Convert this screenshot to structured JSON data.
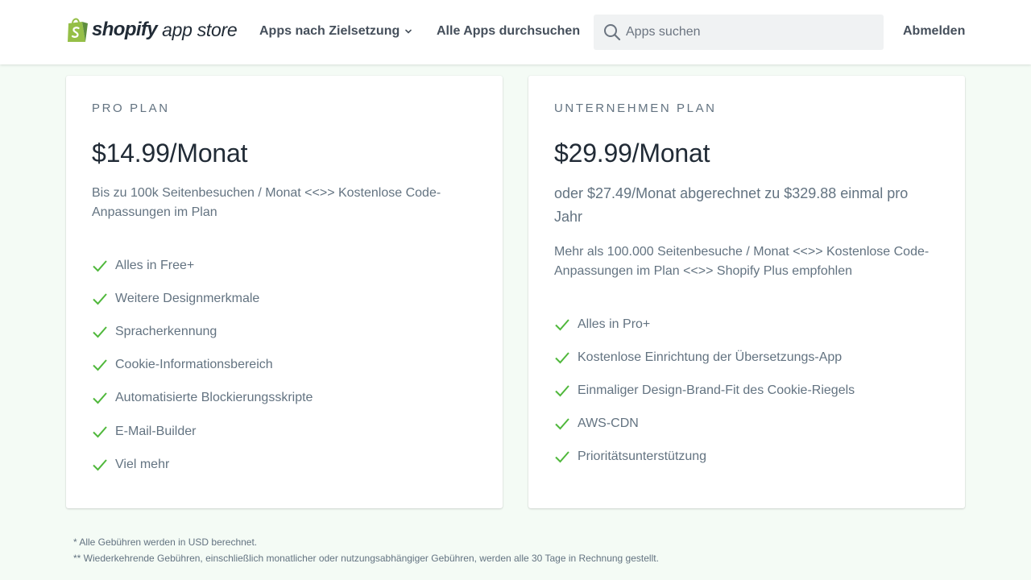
{
  "header": {
    "logo_word": "shopify",
    "logo_sub": "app store",
    "nav_goal_label": "Apps nach Zielsetzung",
    "nav_browse_label": "Alle Apps durchsuchen",
    "search_placeholder": "Apps suchen",
    "logout_label": "Abmelden"
  },
  "plans": [
    {
      "name": "PRO PLAN",
      "price": "$14.99/Monat",
      "description": "Bis zu 100k Seitenbesuchen / Monat <<>> Kostenlose Code-Anpassungen im Plan",
      "features": [
        "Alles in Free+",
        "Weitere Designmerkmale",
        "Spracherkennung",
        "Cookie-Informationsbereich",
        "Automatisierte Blockierungsskripte",
        "E-Mail-Builder",
        "Viel mehr"
      ]
    },
    {
      "name": "UNTERNEHMEN PLAN",
      "price": "$29.99/Monat",
      "annual_note": "oder $27.49/Monat abgerechnet zu $329.88 einmal pro Jahr",
      "description": "Mehr als 100.000 Seitenbesuche / Monat <<>> Kostenlose Code-Anpassungen im Plan <<>> Shopify Plus empfohlen",
      "features": [
        "Alles in Pro+",
        "Kostenlose Einrichtung der Übersetzungs-App",
        "Einmaliger Design-Brand-Fit des Cookie-Riegels",
        "AWS-CDN",
        "Prioritätsunterstützung"
      ]
    }
  ],
  "footnotes": [
    "* Alle Gebühren werden in USD berechnet.",
    "** Wiederkehrende Gebühren, einschließlich monatlicher oder nutzungsabhängiger Gebühren, werden alle 30 Tage in Rechnung gestellt."
  ],
  "colors": {
    "brand_green": "#95bf47",
    "brand_green_dark": "#5e8e3e",
    "check_green": "#50b83c",
    "page_background": "#f4fbf5",
    "text_muted": "#637381"
  },
  "icons": {
    "logo": "shopify-bag-icon",
    "nav_chevron": "chevron-down-icon",
    "search": "search-icon",
    "feature_bullet": "checkmark-icon"
  }
}
